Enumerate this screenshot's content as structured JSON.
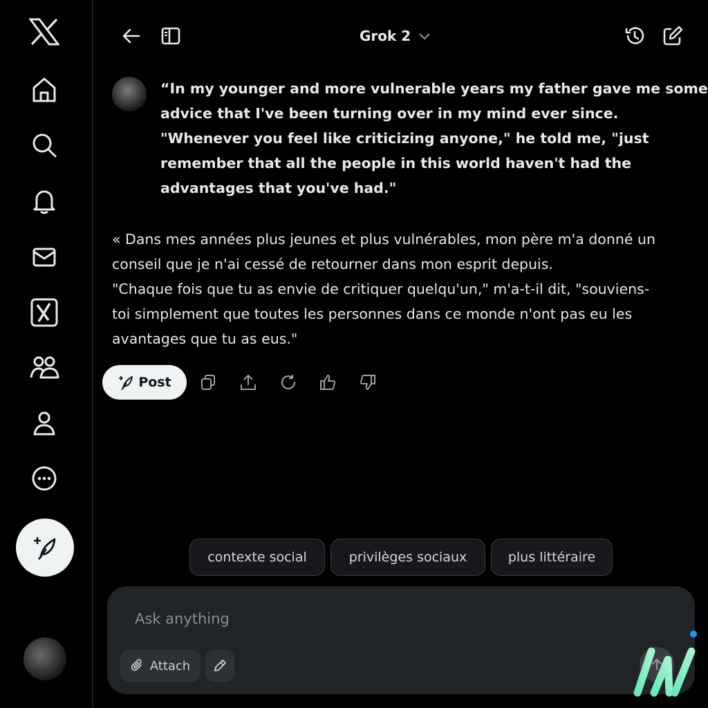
{
  "header": {
    "model_label": "Grok 2",
    "icons": [
      "back-arrow-icon",
      "sidebar-panel-icon",
      "chevron-down-icon",
      "history-icon",
      "new-chat-icon"
    ]
  },
  "sidebar": {
    "items": [
      {
        "name": "x-logo",
        "icon": "x-logo-icon"
      },
      {
        "name": "home",
        "icon": "home-icon"
      },
      {
        "name": "explore",
        "icon": "search-icon"
      },
      {
        "name": "notifications",
        "icon": "bell-icon"
      },
      {
        "name": "messages",
        "icon": "mail-icon"
      },
      {
        "name": "grok",
        "icon": "grok-icon"
      },
      {
        "name": "communities",
        "icon": "people-icon"
      },
      {
        "name": "profile",
        "icon": "person-icon"
      },
      {
        "name": "more",
        "icon": "more-circle-icon"
      }
    ],
    "compose_icon": "feather-plus-icon"
  },
  "conversation": {
    "user_message": [
      "“In my younger and more vulnerable years my father gave me some",
      "advice that I've been turning over in my mind ever since.",
      "\"Whenever you feel like criticizing anyone,\" he told me, \"just",
      "remember that all the people in this world haven't had the",
      "advantages that you've had.\""
    ],
    "assistant_message": [
      "« Dans mes années plus jeunes et plus vulnérables, mon père m'a donné un",
      "conseil que je n'ai cessé de retourner dans mon esprit depuis.",
      "\"Chaque fois que tu as envie de critiquer quelqu'un,\" m'a-t-il dit, \"souviens-",
      "toi simplement que toutes les personnes dans ce monde n'ont pas eu les",
      "avantages que tu as eus.\""
    ]
  },
  "actions": {
    "post_label": "Post",
    "icons": [
      "copy-icon",
      "share-icon",
      "regenerate-icon",
      "thumbs-up-icon",
      "thumbs-down-icon"
    ]
  },
  "suggestions": [
    "contexte social",
    "privilèges sociaux",
    "plus littéraire"
  ],
  "composer": {
    "placeholder": "Ask anything",
    "attach_label": "Attach"
  },
  "colors": {
    "background": "#000000",
    "composer_bg": "#202327",
    "chip_bg": "#16181c",
    "button_light": "#eff3f4",
    "accent_blue": "#1d9bf0",
    "text": "#e7e9ea"
  }
}
